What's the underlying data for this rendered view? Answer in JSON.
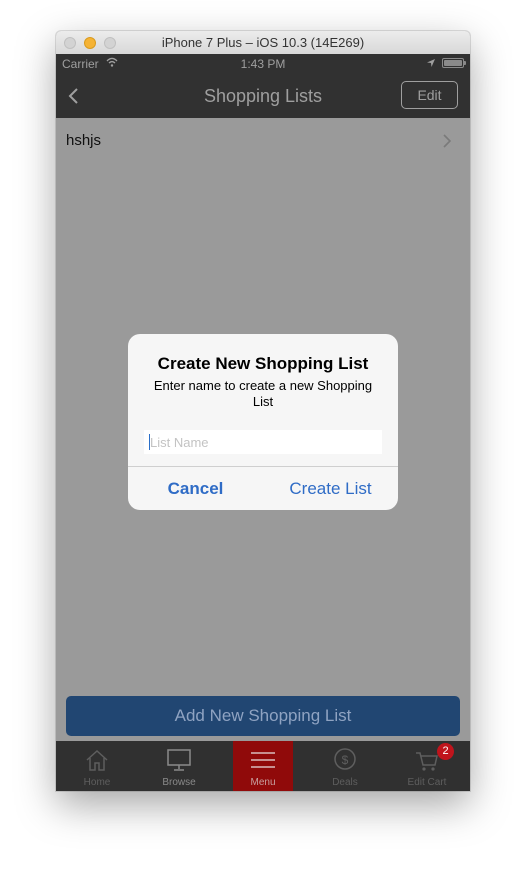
{
  "window": {
    "title": "iPhone 7 Plus – iOS 10.3 (14E269)"
  },
  "status_bar": {
    "carrier": "Carrier",
    "time": "1:43 PM"
  },
  "nav": {
    "title": "Shopping Lists",
    "edit_label": "Edit"
  },
  "lists": [
    {
      "name": "hshjs"
    }
  ],
  "dialog": {
    "title": "Create New Shopping List",
    "message": "Enter name to create a new Shopping List",
    "input_placeholder": "List Name",
    "input_value": "",
    "cancel_label": "Cancel",
    "create_label": "Create List"
  },
  "add_button": {
    "label": "Add New Shopping List"
  },
  "tabbar": {
    "items": [
      {
        "label": "Home",
        "icon": "home-icon"
      },
      {
        "label": "Browse",
        "icon": "monitor-icon"
      },
      {
        "label": "Menu",
        "icon": "hamburger-menu-icon",
        "active": true
      },
      {
        "label": "Deals",
        "icon": "dollar-coin-icon"
      },
      {
        "label": "Edit Cart",
        "icon": "cart-icon",
        "badge": "2"
      }
    ]
  },
  "colors": {
    "accent_blue": "#2f6cc6",
    "add_button_bg": "#214672",
    "active_tab_bg": "#900a0a",
    "badge_red": "#c0141c",
    "bar_dark": "#313131",
    "dim_overlay_bg": "#9a9a9a"
  }
}
